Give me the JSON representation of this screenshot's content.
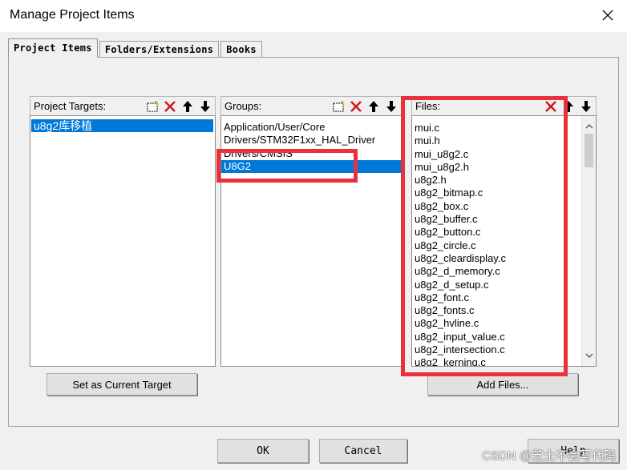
{
  "window": {
    "title": "Manage Project Items"
  },
  "tabs": [
    {
      "label": "Project Items",
      "active": true
    },
    {
      "label": "Folders/Extensions",
      "active": false
    },
    {
      "label": "Books",
      "active": false
    }
  ],
  "targets": {
    "header": "Project Targets:",
    "items": [
      "u8g2库移植"
    ],
    "selected_index": 0
  },
  "groups": {
    "header": "Groups:",
    "items": [
      "Application/User/Core",
      "Drivers/STM32F1xx_HAL_Driver",
      "Drivers/CMSIS",
      "U8G2"
    ],
    "selected_index": 3
  },
  "files": {
    "header": "Files:",
    "items": [
      "mui.c",
      "mui.h",
      "mui_u8g2.c",
      "mui_u8g2.h",
      "u8g2.h",
      "u8g2_bitmap.c",
      "u8g2_box.c",
      "u8g2_buffer.c",
      "u8g2_button.c",
      "u8g2_circle.c",
      "u8g2_cleardisplay.c",
      "u8g2_d_memory.c",
      "u8g2_d_setup.c",
      "u8g2_font.c",
      "u8g2_fonts.c",
      "u8g2_hvline.c",
      "u8g2_input_value.c",
      "u8g2_intersection.c",
      "u8g2_kerning.c"
    ]
  },
  "buttons": {
    "set_current_target": "Set as Current Target",
    "add_files": "Add Files...",
    "ok": "OK",
    "cancel": "Cancel",
    "help": "Help"
  },
  "icons": {
    "new": "new-item-icon",
    "delete": "delete-icon",
    "move_up": "move-up-icon",
    "move_down": "move-down-icon"
  },
  "colors": {
    "selection": "#0078d7",
    "annotation": "#e8313b",
    "delete_icon": "#d01818"
  },
  "watermark": "CSDN @芝士不会写代码"
}
